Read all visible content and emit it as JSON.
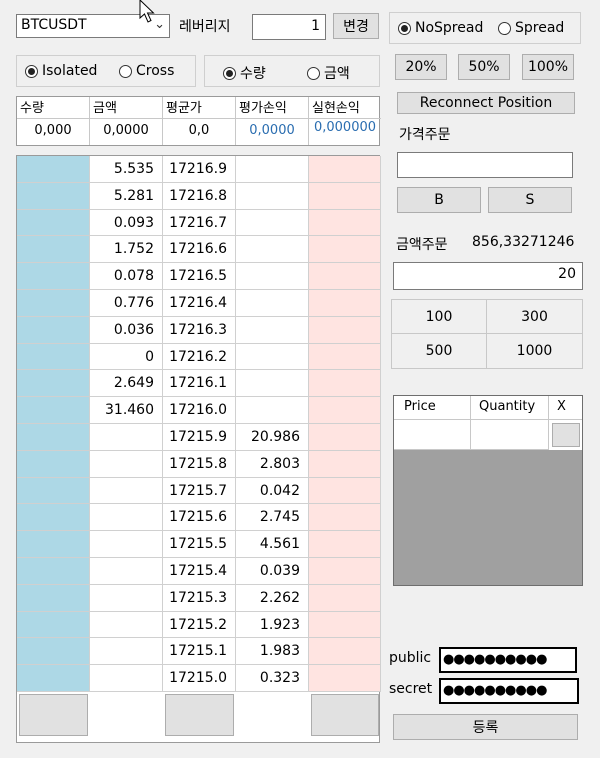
{
  "toolbar": {
    "symbol": "BTCUSDT",
    "leverage_label": "레버리지",
    "leverage_value": "1",
    "change_button": "변경"
  },
  "spread": {
    "no_spread": "NoSpread",
    "spread": "Spread",
    "selected": "NoSpread"
  },
  "margin_mode": {
    "isolated": "Isolated",
    "cross": "Cross",
    "selected": "Isolated"
  },
  "order_mode": {
    "quantity": "수량",
    "amount": "금액",
    "selected": "수량"
  },
  "percent_buttons": [
    "20%",
    "50%",
    "100%"
  ],
  "reconnect_button": "Reconnect Position",
  "position": {
    "headers": [
      "수량",
      "금액",
      "평균가",
      "평가손익",
      "실현손익"
    ],
    "values": [
      "0,000",
      "0,0000",
      "0,0",
      "0,0000",
      "0,000000"
    ]
  },
  "orderbook": [
    {
      "qty": "5.535",
      "price": "17216.9",
      "bid": ""
    },
    {
      "qty": "5.281",
      "price": "17216.8",
      "bid": ""
    },
    {
      "qty": "0.093",
      "price": "17216.7",
      "bid": ""
    },
    {
      "qty": "1.752",
      "price": "17216.6",
      "bid": ""
    },
    {
      "qty": "0.078",
      "price": "17216.5",
      "bid": ""
    },
    {
      "qty": "0.776",
      "price": "17216.4",
      "bid": ""
    },
    {
      "qty": "0.036",
      "price": "17216.3",
      "bid": ""
    },
    {
      "qty": "0",
      "price": "17216.2",
      "bid": ""
    },
    {
      "qty": "2.649",
      "price": "17216.1",
      "bid": ""
    },
    {
      "qty": "31.460",
      "price": "17216.0",
      "bid": ""
    },
    {
      "qty": "",
      "price": "17215.9",
      "bid": "20.986"
    },
    {
      "qty": "",
      "price": "17215.8",
      "bid": "2.803"
    },
    {
      "qty": "",
      "price": "17215.7",
      "bid": "0.042"
    },
    {
      "qty": "",
      "price": "17215.6",
      "bid": "2.745"
    },
    {
      "qty": "",
      "price": "17215.5",
      "bid": "4.561"
    },
    {
      "qty": "",
      "price": "17215.4",
      "bid": "0.039"
    },
    {
      "qty": "",
      "price": "17215.3",
      "bid": "2.262"
    },
    {
      "qty": "",
      "price": "17215.2",
      "bid": "1.923"
    },
    {
      "qty": "",
      "price": "17215.1",
      "bid": "1.983"
    },
    {
      "qty": "",
      "price": "17215.0",
      "bid": "0.323"
    }
  ],
  "limit_order": {
    "label": "가격주문",
    "price_value": "",
    "buy": "B",
    "sell": "S"
  },
  "amount_order": {
    "label": "금액주문",
    "value": "856,33271246",
    "input_value": "20"
  },
  "quick_amounts": [
    "100",
    "300",
    "500",
    "1000"
  ],
  "orders_table": {
    "headers": [
      "Price",
      "Quantity",
      "X"
    ]
  },
  "credentials": {
    "public_label": "public",
    "secret_label": "secret",
    "public_mask": "●●●●●●●●●●",
    "secret_mask": "●●●●●●●●●●",
    "register_button": "등록"
  }
}
